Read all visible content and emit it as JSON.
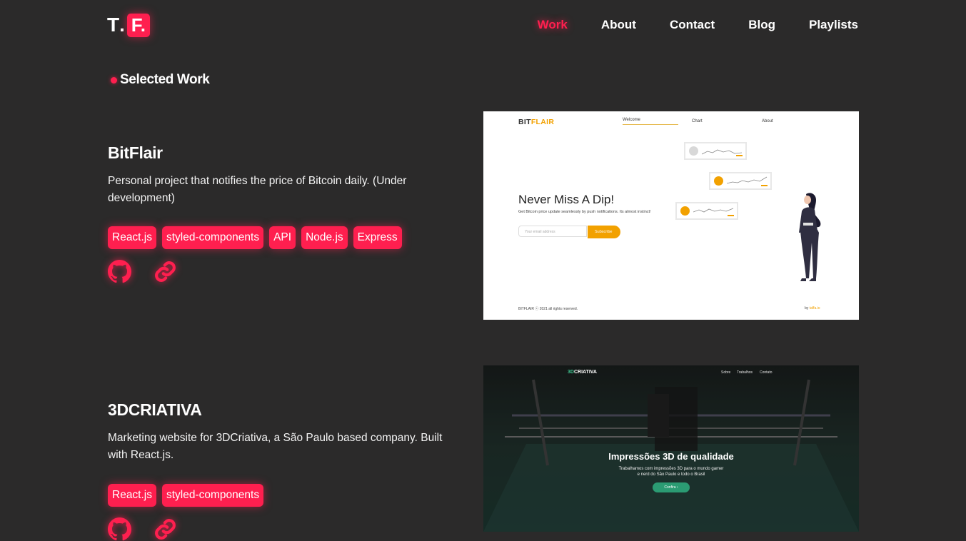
{
  "header": {
    "logo": {
      "letter1": "T",
      "dot": ".",
      "letter2": "F."
    },
    "nav": [
      {
        "label": "Work",
        "active": true
      },
      {
        "label": "About",
        "active": false
      },
      {
        "label": "Contact",
        "active": false
      },
      {
        "label": "Blog",
        "active": false
      },
      {
        "label": "Playlists",
        "active": false
      }
    ]
  },
  "section": {
    "title": "Selected Work"
  },
  "projects": [
    {
      "title": "BitFlair",
      "description": "Personal project that notifies the price of Bitcoin daily. (Under development)",
      "tags": [
        "React.js",
        "styled-components",
        "API",
        "Node.js",
        "Express"
      ],
      "links": [
        "github-icon",
        "link-icon"
      ],
      "screenshot": {
        "logo_part1": "BIT",
        "logo_part2": "FLAIR",
        "nav": [
          "Welcome",
          "Chart",
          "About"
        ],
        "headline": "Never Miss A Dip!",
        "subtext": "Get Bitcoin price update seamlessly by push notifications. Its almost instinct!",
        "input_placeholder": "Your email address",
        "button": "Subscribe",
        "footer_left": "BITFLAIR ⓒ 2021 all rights reserved.",
        "footer_right_prefix": "by ",
        "footer_right_link": "taffa.io"
      }
    },
    {
      "title": "3DCRIATIVA",
      "description": "Marketing website for 3DCriativa, a São Paulo based company. Built with React.js.",
      "tags": [
        "React.js",
        "styled-components"
      ],
      "links": [
        "github-icon",
        "link-icon"
      ],
      "screenshot": {
        "logo_part1": "3D",
        "logo_part2": "CRIATIVA",
        "nav": [
          "Sobre",
          "Trabalhos",
          "Contato"
        ],
        "headline": "Impressões 3D de qualidade",
        "subtext_line1": "Trabalhamos com impressões 3D para o mundo gamer",
        "subtext_line2": "e nerd do São Paulo e todo o Brasil",
        "button": "Confira ›"
      }
    }
  ],
  "colors": {
    "accent": "#ff1f4f",
    "background": "#2b2a2a",
    "bitflair_orange": "#f2a100",
    "criativa_green": "#2b9b73"
  }
}
